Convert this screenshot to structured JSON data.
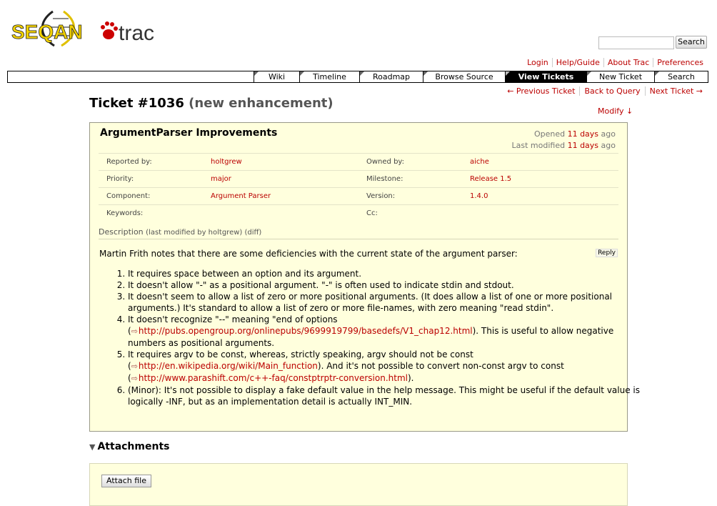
{
  "logo": {
    "text_1": "SEQAN",
    "text_2": "trac"
  },
  "search": {
    "button_label": "Search",
    "value": ""
  },
  "metanav": [
    "Login",
    "Help/Guide",
    "About Trac",
    "Preferences"
  ],
  "mainnav": [
    {
      "label": "Wiki",
      "active": false
    },
    {
      "label": "Timeline",
      "active": false
    },
    {
      "label": "Roadmap",
      "active": false
    },
    {
      "label": "Browse Source",
      "active": false
    },
    {
      "label": "View Tickets",
      "active": true
    },
    {
      "label": "New Ticket",
      "active": false
    },
    {
      "label": "Search",
      "active": false
    }
  ],
  "ctxnav": [
    "← Previous Ticket",
    "Back to Query",
    "Next Ticket →"
  ],
  "ticket": {
    "number": "Ticket #1036",
    "status": "(new enhancement)",
    "modify_label": "Modify ↓",
    "summary": "ArgumentParser Improvements",
    "opened_label": "Opened",
    "opened_value": "11 days",
    "opened_suffix": "ago",
    "modified_label": "Last modified",
    "modified_value": "11 days",
    "modified_suffix": "ago",
    "properties": [
      {
        "l1": "Reported by:",
        "v1": "holtgrew",
        "l2": "Owned by:",
        "v2": "aiche"
      },
      {
        "l1": "Priority:",
        "v1": "major",
        "l2": "Milestone:",
        "v2": "Release 1.5"
      },
      {
        "l1": "Component:",
        "v1": "Argument Parser",
        "l2": "Version:",
        "v2": "1.4.0"
      },
      {
        "l1": "Keywords:",
        "v1": "",
        "l2": "Cc:",
        "v2": ""
      }
    ],
    "description_label": "Description",
    "description_sub": "(last modified by holtgrew) (diff)",
    "reply_label": "Reply",
    "intro": "Martin Frith notes that there are some deficiencies with the current state of the argument parser:",
    "items": {
      "i1": "It requires space between an option and its argument.",
      "i2": "It doesn't allow \"-\" as a positional argument. \"-\" is often used to indicate stdin and stdout.",
      "i3": "It doesn't seem to allow a list of zero or more positional arguments. (It does allow a list of one or more positional arguments.) It's standard to allow a list of zero or more file-names, with zero meaning \"read stdin\".",
      "i4_a": "It doesn't recognize \"--\" meaning \"end of options (",
      "i4_link": "http://pubs.opengroup.org/onlinepubs/9699919799/basedefs/V1_chap12.html",
      "i4_b": "). This is useful to allow negative numbers as positional arguments.",
      "i5_a": "It requires argv to be const, whereas, strictly speaking, argv should not be const (",
      "i5_link1": "http://en.wikipedia.org/wiki/Main_function",
      "i5_b": "). And it's not possible to convert non-const argv to const (",
      "i5_link2": "http://www.parashift.com/c++-faq/constptrptr-conversion.html",
      "i5_c": ").",
      "i6": "(Minor): It's not possible to display a fake default value in the help message. This might be useful if the default value is logically -INF, but as an implementation detail is actually INT_MIN."
    }
  },
  "attachments": {
    "title": "Attachments",
    "button_label": "Attach file"
  },
  "colors": {
    "link": "#bb0000",
    "ticket_bg": "#ffffdd",
    "logo_yellow": "#f2d100",
    "logo_red": "#cc0000"
  }
}
